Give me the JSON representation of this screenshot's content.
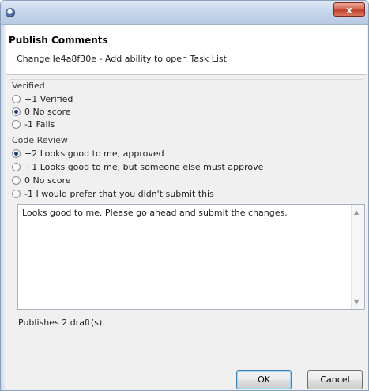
{
  "window": {
    "title": "",
    "close_glyph": "x"
  },
  "header": {
    "title": "Publish Comments",
    "description": "Change Ie4a8f30e - Add ability to open Task List"
  },
  "verified": {
    "label": "Verified",
    "options": [
      {
        "label": "+1 Verified",
        "checked": false
      },
      {
        "label": "0 No score",
        "checked": true
      },
      {
        "label": "-1 Fails",
        "checked": false
      }
    ]
  },
  "code_review": {
    "label": "Code Review",
    "options": [
      {
        "label": "+2 Looks good to me, approved",
        "checked": true
      },
      {
        "label": "+1 Looks good to me, but someone else must approve",
        "checked": false
      },
      {
        "label": "0 No score",
        "checked": false
      },
      {
        "label": "-1 I would prefer that you didn't submit this",
        "checked": false
      }
    ]
  },
  "comment": {
    "text": "Looks good to me. Please go ahead and submit the changes."
  },
  "status": {
    "drafts": "Publishes 2 draft(s)."
  },
  "buttons": {
    "ok": "OK",
    "cancel": "Cancel"
  },
  "icons": {
    "app": "eclipse-icon",
    "close": "close-icon"
  }
}
